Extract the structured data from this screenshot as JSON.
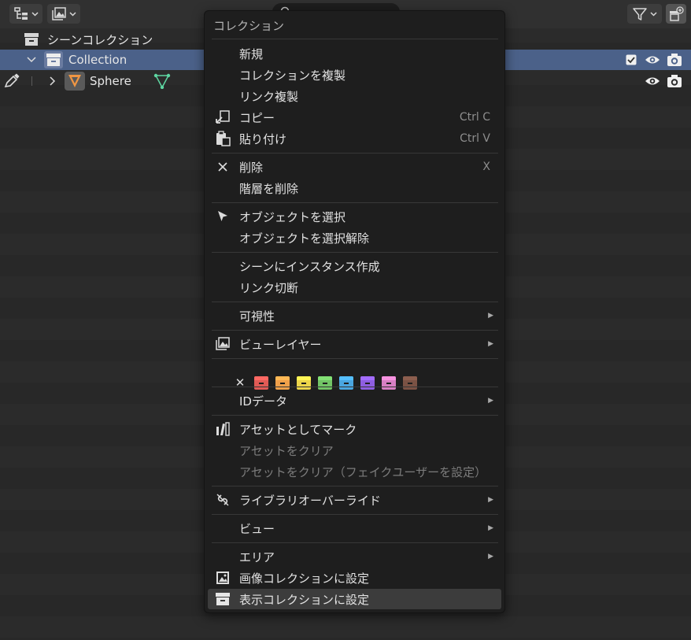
{
  "header": {
    "search_placeholder": ""
  },
  "outliner": {
    "scene_collection": "シーンコレクション",
    "collection": "Collection",
    "object": "Sphere"
  },
  "menu": {
    "title": "コレクション",
    "items": [
      {
        "label": "新規"
      },
      {
        "label": "コレクションを複製"
      },
      {
        "label": "リンク複製"
      },
      {
        "label": "コピー",
        "shortcut": "Ctrl C",
        "icon": "copy-icon"
      },
      {
        "label": "貼り付け",
        "shortcut": "Ctrl V",
        "icon": "paste-icon"
      },
      {
        "label": "削除",
        "shortcut": "X",
        "icon": "x-icon"
      },
      {
        "label": "階層を削除"
      },
      {
        "label": "オブジェクトを選択",
        "icon": "cursor-icon"
      },
      {
        "label": "オブジェクトを選択解除"
      },
      {
        "label": "シーンにインスタンス作成"
      },
      {
        "label": "リンク切断"
      },
      {
        "label": "可視性",
        "submenu": true
      },
      {
        "label": "ビューレイヤー",
        "submenu": true,
        "icon": "image-layers-icon"
      },
      {
        "label": "IDデータ",
        "submenu": true
      },
      {
        "label": "アセットとしてマーク",
        "icon": "asset-icon"
      },
      {
        "label": "アセットをクリア",
        "disabled": true
      },
      {
        "label": "アセットをクリア（フェイクユーザーを設定）",
        "disabled": true
      },
      {
        "label": "ライブラリオーバーライド",
        "submenu": true,
        "icon": "library-override-icon"
      },
      {
        "label": "ビュー",
        "submenu": true
      },
      {
        "label": "エリア",
        "submenu": true
      },
      {
        "label": "画像コレクションに設定",
        "icon": "image-icon"
      },
      {
        "label": "表示コレクションに設定",
        "icon": "collection-icon",
        "active": true
      }
    ],
    "color_tags": [
      "#e05a55",
      "#f0a04a",
      "#ecd54a",
      "#72c466",
      "#4aa6e0",
      "#8e5ee0",
      "#d77fc3",
      "#7a5244"
    ],
    "submenu_arrow": "▶",
    "clear_color_glyph": "✕"
  }
}
